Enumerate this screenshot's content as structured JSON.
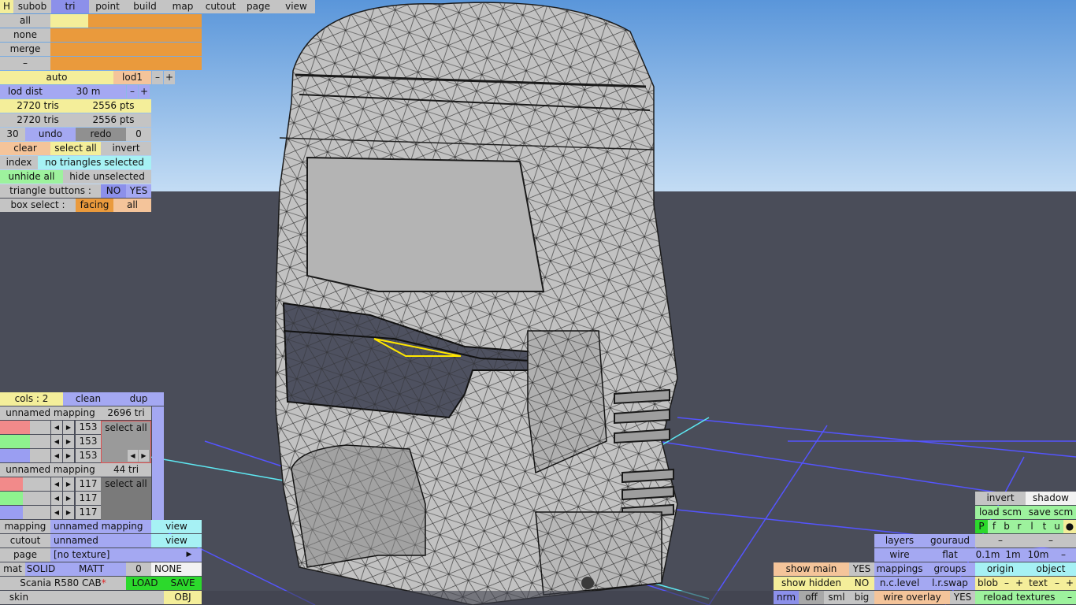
{
  "colors": {
    "sky_top": "#5a96da",
    "sky_bottom": "#c3dcf4",
    "ground": "#4a4d59",
    "grid": "#5454ff",
    "grid_axis": "#5ee8f2",
    "selection": "#ffe600"
  },
  "toolbar": {
    "h": "H",
    "subob": "subob",
    "tri": "tri",
    "point": "point",
    "build": "build",
    "map": "map",
    "cutout": "cutout",
    "page": "page",
    "view": "view"
  },
  "sel": {
    "all": "all",
    "none": "none",
    "merge": "merge",
    "dash": "–"
  },
  "lod": {
    "auto": "auto",
    "lod1": "lod1",
    "minus": "–",
    "plus": "+",
    "dist_label": "lod dist",
    "dist_value": "30 m"
  },
  "stats": {
    "tris1": "2720 tris",
    "pts1": "2556 pts",
    "tris2": "2720 tris",
    "pts2": "2556 pts"
  },
  "history": {
    "count": "30",
    "undo": "undo",
    "redo": "redo",
    "redo_count": "0"
  },
  "actions": {
    "clear": "clear",
    "select_all": "select all",
    "invert": "invert",
    "index": "index",
    "status": "no triangles selected",
    "unhide_all": "unhide all",
    "hide_unselected": "hide unselected"
  },
  "tri_buttons": {
    "label": "triangle buttons :",
    "no": "NO",
    "yes": "YES"
  },
  "box_select": {
    "label": "box select :",
    "facing": "facing",
    "all": "all"
  },
  "cols": {
    "label": "cols : 2",
    "clean": "clean",
    "dup": "dup"
  },
  "mappings": [
    {
      "name": "unnamed mapping",
      "tris": "2696 tri",
      "values": [
        "153",
        "153",
        "153"
      ],
      "select_all": "select all"
    },
    {
      "name": "unnamed mapping",
      "tris": "44 tri",
      "values": [
        "117",
        "117",
        "117"
      ],
      "select_all": "select all"
    }
  ],
  "props": {
    "mapping_label": "mapping",
    "mapping_value": "unnamed mapping",
    "view": "view",
    "cutout_label": "cutout",
    "cutout_value": "unnamed",
    "view2": "view",
    "page_label": "page",
    "page_value": "[no texture]",
    "page_arrow": "▶",
    "mat": "mat",
    "solid": "SOLID",
    "matt": "MATT",
    "zero": "0",
    "none": "NONE",
    "object_name": "Scania R580 CAB",
    "asterisk": "*",
    "load": "LOAD",
    "save": "SAVE",
    "skin": "skin",
    "obj": "OBJ"
  },
  "right": {
    "invert": "invert",
    "shadow": "shadow",
    "load_scm": "load scm",
    "save_scm": "save scm",
    "flags": [
      "P",
      "f",
      "b",
      "r",
      "l",
      "t",
      "u",
      "●"
    ],
    "layers": "layers",
    "gouraud": "gouraud",
    "dash": "–",
    "wire": "wire",
    "flat": "flat",
    "d01": "0.1m",
    "d1": "1m",
    "d10": "10m",
    "show_main": "show main",
    "yes1": "YES",
    "mappings": "mappings",
    "groups": "groups",
    "origin": "origin",
    "object": "object",
    "show_hidden": "show hidden",
    "no1": "NO",
    "nc_level": "n.c.level",
    "lr_swap": "l.r.swap",
    "blob": "blob",
    "text": "text",
    "minus": "–",
    "plus": "+",
    "nrm": "nrm",
    "off": "off",
    "sml": "sml",
    "big": "big",
    "wire_overlay": "wire overlay",
    "yes2": "YES",
    "reload": "reload textures"
  }
}
